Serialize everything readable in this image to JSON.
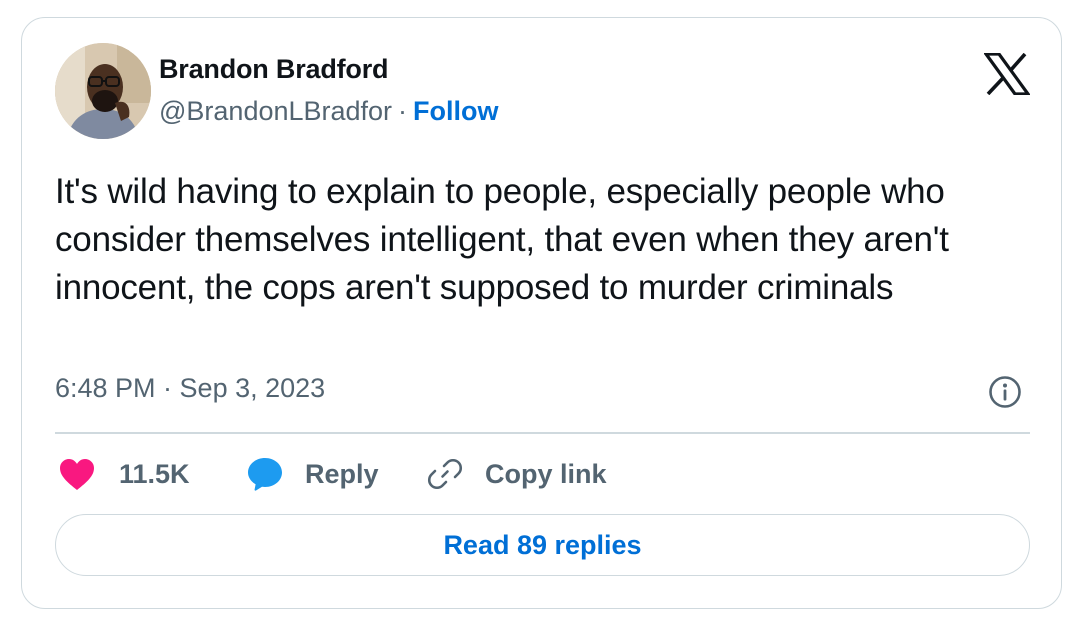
{
  "author": {
    "name": "Brandon Bradford",
    "handle": "@BrandonLBradfor",
    "separator": "·",
    "follow_label": "Follow"
  },
  "tweet": {
    "text": "It's wild having to explain to people, especially people who consider themselves intelligent, that even when they aren't innocent, the cops aren't supposed to murder criminals",
    "timestamp": "6:48 PM · Sep 3, 2023"
  },
  "actions": {
    "like_count": "11.5K",
    "reply_label": "Reply",
    "copy_label": "Copy link"
  },
  "read_replies_label": "Read 89 replies",
  "icons": {
    "logo": "x-logo-icon",
    "info": "info-icon",
    "like": "heart-icon",
    "reply": "speech-bubble-icon",
    "copy": "link-icon"
  },
  "colors": {
    "like": "#f91880",
    "reply": "#1d9bf0",
    "link_blue": "#006fd6",
    "secondary_text": "#536471",
    "border": "#cfd9de"
  }
}
